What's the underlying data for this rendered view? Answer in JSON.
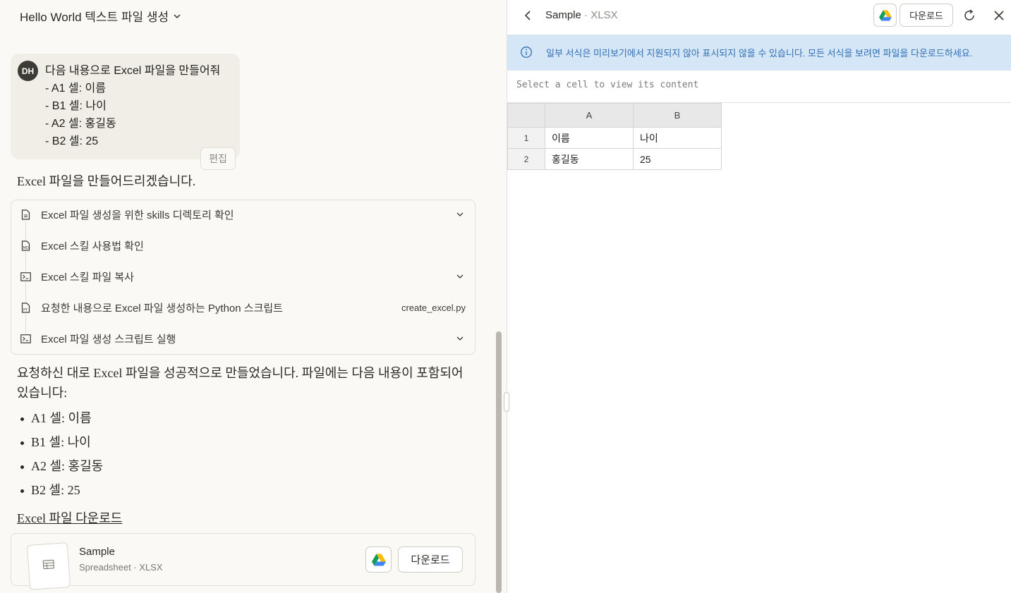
{
  "chat": {
    "title": "Hello World 텍스트 파일 생성",
    "user": {
      "avatar": "DH",
      "lines": [
        "다음 내용으로 Excel 파일을 만들어줘",
        "- A1 셀: 이름",
        "- B1 셀: 나이",
        "- A2 셀: 홍길동",
        "- B2 셀: 25"
      ],
      "edit_label": "편집"
    },
    "response_intro": "Excel 파일을 만들어드리겠습니다.",
    "tools": [
      {
        "label": "Excel 파일 생성을 위한 skills 디렉토리 확인",
        "icon": "file-icon",
        "expandable": true
      },
      {
        "label": "Excel 스킬 사용법 확인",
        "icon": "markdown-file-icon",
        "expandable": false
      },
      {
        "label": "Excel 스킬 파일 복사",
        "icon": "terminal-icon",
        "expandable": true
      },
      {
        "label": "요청한 내용으로 Excel 파일 생성하는 Python 스크립트",
        "icon": "python-file-icon",
        "expandable": false,
        "filename": "create_excel.py"
      },
      {
        "label": "Excel 파일 생성 스크립트 실행",
        "icon": "terminal-icon",
        "expandable": true
      }
    ],
    "response_body": "요청하신 대로 Excel 파일을 성공적으로 만들었습니다. 파일에는 다음 내용이 포함되어 있습니다:",
    "bullets": [
      "A1 셀: 이름",
      "B1 셀: 나이",
      "A2 셀: 홍길동",
      "B2 셀: 25"
    ],
    "download_link": "Excel 파일 다운로드",
    "file_card": {
      "name": "Sample",
      "meta": "Spreadsheet · XLSX",
      "download_label": "다운로드"
    }
  },
  "preview": {
    "title": "Sample",
    "ext": "XLSX",
    "title_sep": " · ",
    "download_label": "다운로드",
    "banner": "일부 서식은 미리보기에서 지원되지 않아 표시되지 않을 수 있습니다. 모든 서식을 보려면 파일을 다운로드하세요.",
    "cell_placeholder": "Select a cell to view its content",
    "sheet": {
      "columns": [
        "A",
        "B"
      ],
      "rows": [
        {
          "num": "1",
          "cells": [
            "이름",
            "나이"
          ]
        },
        {
          "num": "2",
          "cells": [
            "홍길동",
            "25"
          ]
        }
      ]
    }
  },
  "colors": {
    "accent_blue": "#2f6fb3",
    "banner_bg": "#d5e6f7",
    "page_bg": "#faf9f6"
  }
}
